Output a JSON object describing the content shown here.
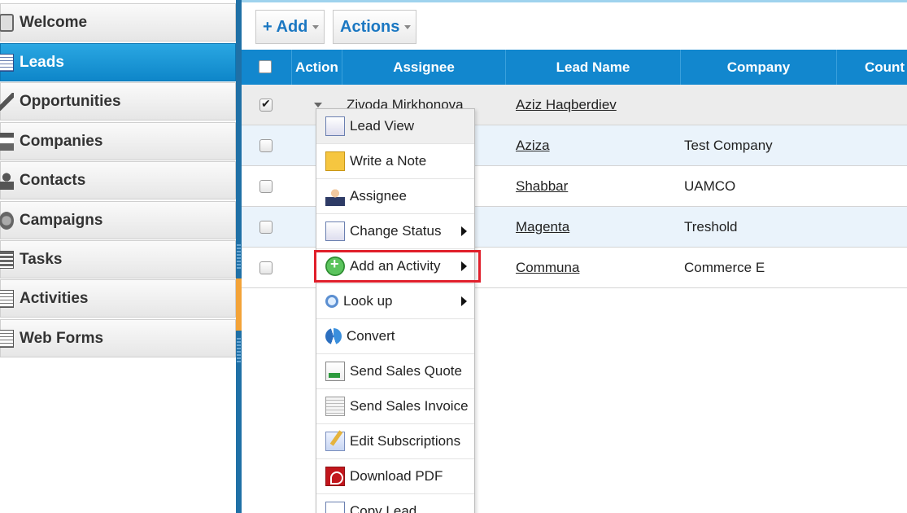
{
  "sidebar": {
    "items": [
      {
        "label": "Welcome",
        "icon": "welcome-icon",
        "active": false
      },
      {
        "label": "Leads",
        "icon": "leads-icon",
        "active": true
      },
      {
        "label": "Opportunities",
        "icon": "opportunities-icon",
        "active": false
      },
      {
        "label": "Companies",
        "icon": "companies-icon",
        "active": false
      },
      {
        "label": "Contacts",
        "icon": "contacts-icon",
        "active": false
      },
      {
        "label": "Campaigns",
        "icon": "campaigns-icon",
        "active": false
      },
      {
        "label": "Tasks",
        "icon": "tasks-icon",
        "active": false
      },
      {
        "label": "Activities",
        "icon": "activities-icon",
        "active": false
      },
      {
        "label": "Web Forms",
        "icon": "web-forms-icon",
        "active": false
      }
    ]
  },
  "toolbar": {
    "add_label": "+ Add",
    "actions_label": "Actions"
  },
  "table": {
    "columns": [
      "Action",
      "Assignee",
      "Lead Name",
      "Company",
      "Count"
    ],
    "rows": [
      {
        "checked": true,
        "assignee": "Zivoda Mirkhonova",
        "lead_name": "Aziz Haqberdiev",
        "company": ""
      },
      {
        "checked": false,
        "assignee": "",
        "lead_name": "Aziza",
        "company": "Test Company"
      },
      {
        "checked": false,
        "assignee": "",
        "lead_name": "Shabbar",
        "company": "UAMCO"
      },
      {
        "checked": false,
        "assignee": "",
        "lead_name": "Magenta",
        "company": "Treshold"
      },
      {
        "checked": false,
        "assignee": "",
        "lead_name": "Communa",
        "company": "Commerce E"
      }
    ]
  },
  "context_menu": {
    "items": [
      {
        "label": "Lead View",
        "icon": "lead-view-icon",
        "submenu": false
      },
      {
        "label": "Write a Note",
        "icon": "note-icon",
        "submenu": false
      },
      {
        "label": "Assignee",
        "icon": "assignee-icon",
        "submenu": false
      },
      {
        "label": "Change Status",
        "icon": "change-status-icon",
        "submenu": true
      },
      {
        "label": "Add an Activity",
        "icon": "add-activity-icon",
        "submenu": true,
        "highlighted": true
      },
      {
        "label": "Look up",
        "icon": "lookup-icon",
        "submenu": true
      },
      {
        "label": "Convert",
        "icon": "convert-icon",
        "submenu": false
      },
      {
        "label": "Send Sales Quote",
        "icon": "sales-quote-icon",
        "submenu": false
      },
      {
        "label": "Send Sales Invoice",
        "icon": "sales-invoice-icon",
        "submenu": false
      },
      {
        "label": "Edit Subscriptions",
        "icon": "edit-subscriptions-icon",
        "submenu": false
      },
      {
        "label": "Download PDF",
        "icon": "pdf-icon",
        "submenu": false
      },
      {
        "label": "Copy Lead",
        "icon": "copy-lead-icon",
        "submenu": false
      }
    ]
  },
  "colors": {
    "accent": "#1287ce",
    "active_nav": "#1a9bd8",
    "highlight_border": "#e01f2b"
  }
}
